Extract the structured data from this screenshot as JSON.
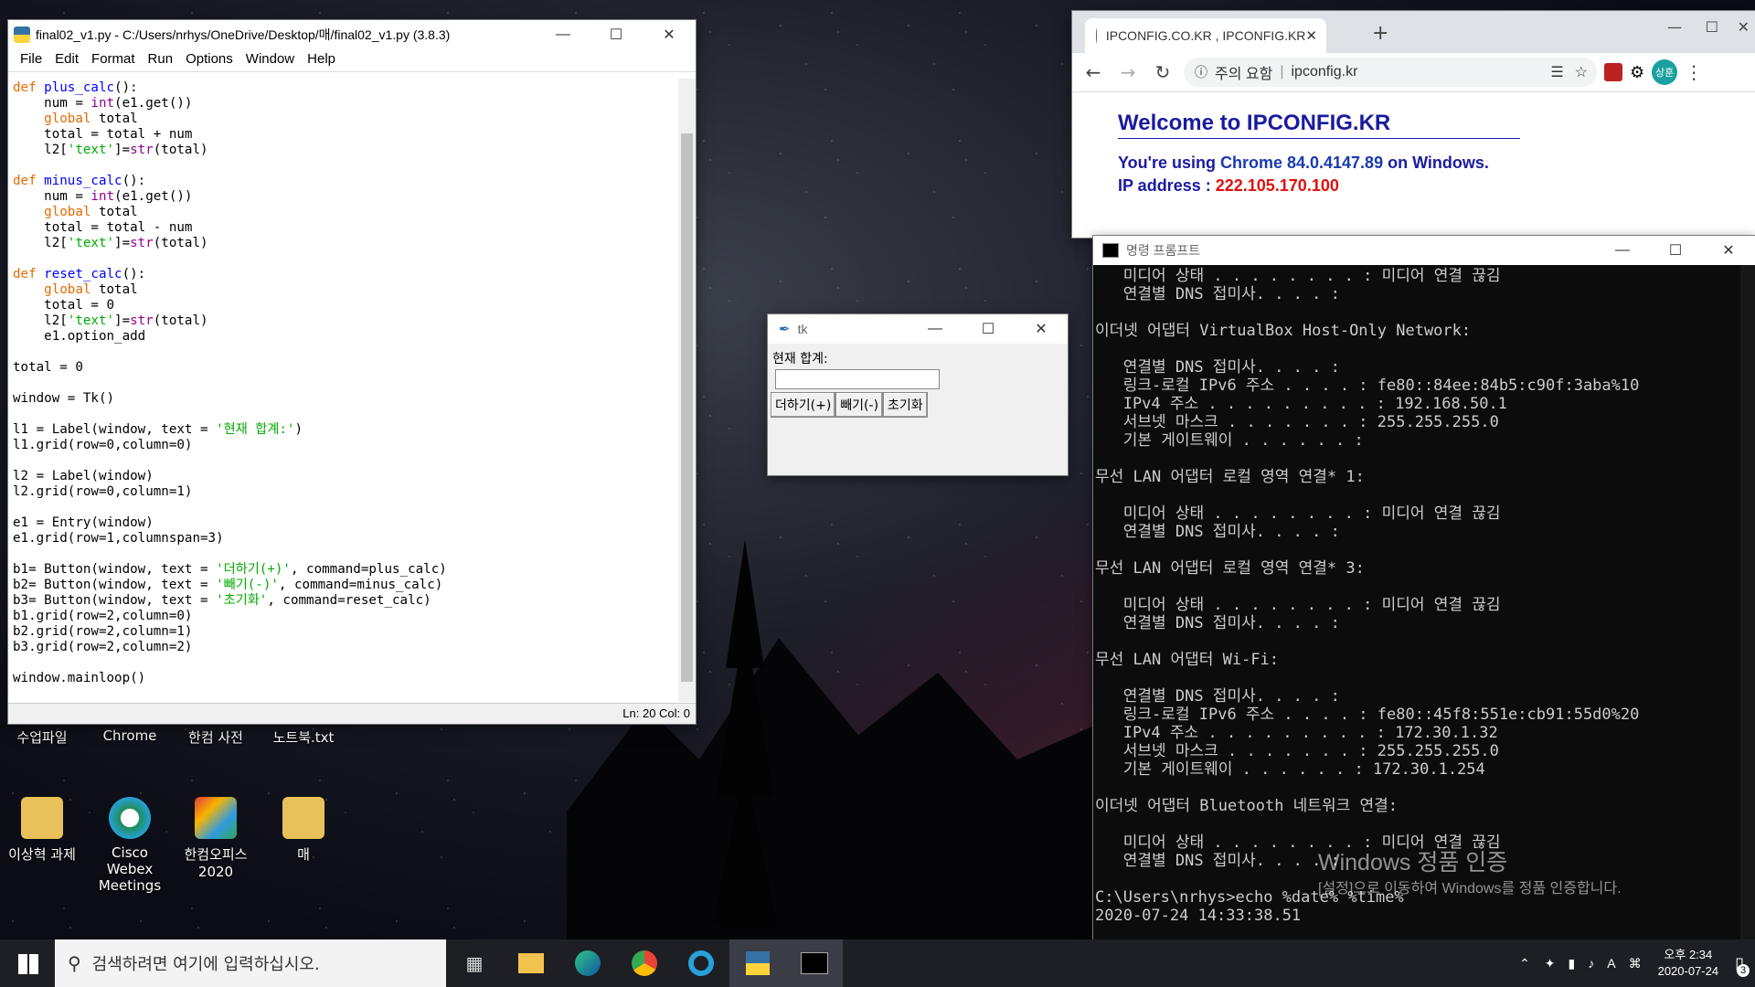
{
  "desktop": {
    "icons": [
      {
        "label": "수업파일"
      },
      {
        "label": "Chrome"
      },
      {
        "label": "한컴 사전"
      },
      {
        "label": "노트북.txt"
      },
      {
        "label": "이상혁 과제"
      },
      {
        "label": "Cisco Webex Meetings"
      },
      {
        "label": "한컴오피스 2020"
      },
      {
        "label": "매"
      }
    ]
  },
  "idle": {
    "title": "final02_v1.py - C:/Users/nrhys/OneDrive/Desktop/매/final02_v1.py (3.8.3)",
    "menu": [
      "File",
      "Edit",
      "Format",
      "Run",
      "Options",
      "Window",
      "Help"
    ],
    "status": "Ln: 20   Col: 0"
  },
  "chrome": {
    "tab_title": "IPCONFIG.CO.KR , IPCONFIG.KR",
    "security_label": "주의 요함",
    "url": "ipconfig.kr",
    "avatar": "상훈",
    "heading": "Welcome to IPCONFIG.KR",
    "using_prefix": "You're using ",
    "browser": "Chrome 84.0.4147.89",
    "using_suffix": " on Windows.",
    "ip_label": "IP address : ",
    "ip_value": "222.105.170.100"
  },
  "cmd": {
    "title": "명령 프롬프트",
    "lines": [
      "   미디어 상태 . . . . . . . . : 미디어 연결 끊김",
      "   연결별 DNS 접미사. . . . :",
      "",
      "이더넷 어댑터 VirtualBox Host-Only Network:",
      "",
      "   연결별 DNS 접미사. . . . :",
      "   링크-로컬 IPv6 주소 . . . . : fe80::84ee:84b5:c90f:3aba%10",
      "   IPv4 주소 . . . . . . . . . : 192.168.50.1",
      "   서브넷 마스크 . . . . . . . : 255.255.255.0",
      "   기본 게이트웨이 . . . . . . :",
      "",
      "무선 LAN 어댑터 로컬 영역 연결* 1:",
      "",
      "   미디어 상태 . . . . . . . . : 미디어 연결 끊김",
      "   연결별 DNS 접미사. . . . :",
      "",
      "무선 LAN 어댑터 로컬 영역 연결* 3:",
      "",
      "   미디어 상태 . . . . . . . . : 미디어 연결 끊김",
      "   연결별 DNS 접미사. . . . :",
      "",
      "무선 LAN 어댑터 Wi-Fi:",
      "",
      "   연결별 DNS 접미사. . . . :",
      "   링크-로컬 IPv6 주소 . . . . : fe80::45f8:551e:cb91:55d0%20",
      "   IPv4 주소 . . . . . . . . . : 172.30.1.32",
      "   서브넷 마스크 . . . . . . . : 255.255.255.0",
      "   기본 게이트웨이 . . . . . . : 172.30.1.254",
      "",
      "이더넷 어댑터 Bluetooth 네트워크 연결:",
      "",
      "   미디어 상태 . . . . . . . . : 미디어 연결 끊김",
      "   연결별 DNS 접미사. . . . :",
      "",
      "C:\\Users\\nrhys>echo %date% %time%",
      "2020-07-24 14:33:38.51"
    ]
  },
  "tk": {
    "title": "tk",
    "label": "현재 합계:",
    "buttons": [
      "더하기(+)",
      "빼기(-)",
      "초기화"
    ]
  },
  "watermark": {
    "title": "Windows 정품 인증",
    "subtitle": "[설정]으로 이동하여 Windows를 정품 인증합니다."
  },
  "taskbar": {
    "search_placeholder": "검색하려면 여기에 입력하십시오.",
    "time": "오후 2:34",
    "date": "2020-07-24",
    "notif_count": "3"
  }
}
